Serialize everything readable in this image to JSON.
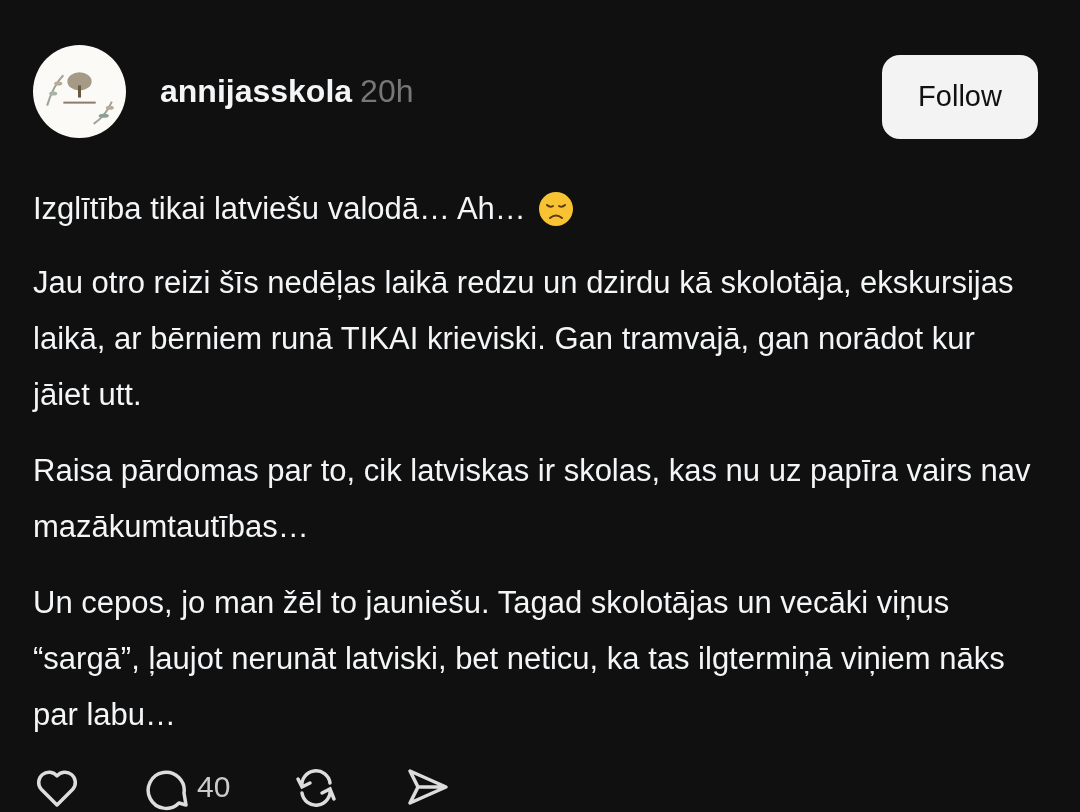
{
  "post": {
    "author": "annijasskola",
    "time": "20h",
    "follow_button": "Follow",
    "paragraphs": [
      "Izglītība tikai latviešu valodā… Ah…",
      "Jau otro reizi šīs nedēļas laikā redzu un dzirdu kā skolotāja, ekskursijas laikā, ar bērniem runā TIKAI krieviski. Gan tramvajā, gan norādot kur jāiet utt.",
      "Raisa pārdomas par to, cik latviskas ir skolas, kas nu uz papīra vairs nav mazākumtautības…",
      "Un cepos, jo man žēl to jauniešu. Tagad skolotājas un vecāki viņus “sargā”, ļaujot nerunāt latviski, bet neticu, ka tas ilgtermiņā viņiem nāks par labu…"
    ],
    "reply_count": "40"
  }
}
